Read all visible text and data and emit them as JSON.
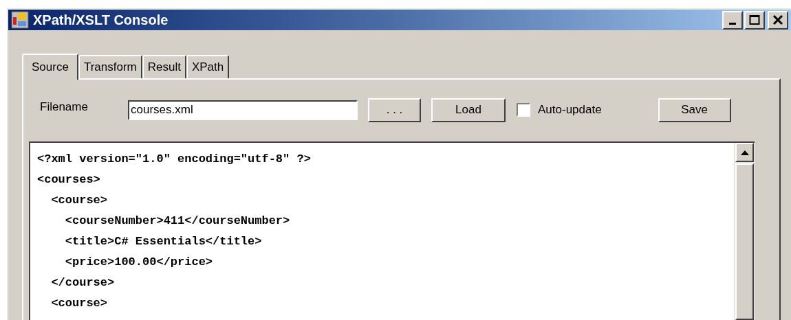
{
  "window": {
    "title": "XPath/XSLT Console"
  },
  "tabs": [
    {
      "label": "Source",
      "selected": true
    },
    {
      "label": "Transform",
      "selected": false
    },
    {
      "label": "Result",
      "selected": false
    },
    {
      "label": "XPath",
      "selected": false
    }
  ],
  "filename": {
    "label": "Filename",
    "value": "courses.xml"
  },
  "browse_button": ". . .",
  "load_button": "Load",
  "auto_update": {
    "label": "Auto-update",
    "checked": false
  },
  "save_button": "Save",
  "editor_lines": [
    "<?xml version=\"1.0\" encoding=\"utf-8\" ?>",
    "<courses>",
    "  <course>",
    "    <courseNumber>411</courseNumber>",
    "    <title>C# Essentials</title>",
    "    <price>100.00</price>",
    "  </course>",
    "  <course>"
  ]
}
